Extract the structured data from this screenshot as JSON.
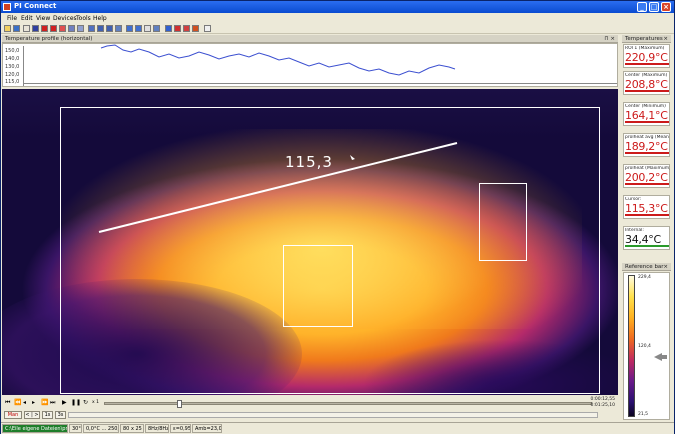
{
  "window": {
    "title": "PI Connect"
  },
  "menu": [
    "File",
    "Edit",
    "View",
    "Devices",
    "Tools",
    "Help"
  ],
  "panels": {
    "profile_title": "Temperature profile (horizontal)",
    "temps_title": "Temperatures",
    "ref_title": "Reference bar"
  },
  "profile": {
    "y_ticks": [
      "150,0",
      "140,0",
      "130,0",
      "120,0",
      "115,0"
    ],
    "line_color": "#3b4fd0"
  },
  "thermal": {
    "line_value": "115,3"
  },
  "temperatures": [
    {
      "label": "ROI 1 (Maximum)",
      "value": "220,9°C"
    },
    {
      "label": "Center (Maximum)",
      "value": "208,8°C"
    },
    {
      "label": "Center (Minimum)",
      "value": "164,1°C"
    },
    {
      "label": "prolheat avg (Mean val",
      "value": "189,2°C"
    },
    {
      "label": "prolheat (Maximum)",
      "value": "200,2°C"
    },
    {
      "label": "Cursor:",
      "value": "115,3°C"
    },
    {
      "label": "Internal:",
      "value": "34,4°C"
    }
  ],
  "reference": {
    "max": "229,4",
    "mid": "120,4",
    "min": "21,5"
  },
  "playback": {
    "time_top": "0:00:12,55",
    "time_bottom": "0:01:25,10",
    "speed": "x 1"
  },
  "bottom_buttons": [
    "Man",
    "< | >",
    "1s",
    "3s"
  ],
  "status": {
    "file": "C:\\Eile eigene Dateien\\prh3.ravi",
    "fov": "30°",
    "range": "0,0°C ... 250,0°C",
    "res": "80 x 25",
    "freq": "8Hz/8Hz",
    "eps": "ε=0,950",
    "amb": "Amb=23,0°C"
  },
  "colors": {
    "accent": "#0a4bd0",
    "temp_text": "#cc1a1a",
    "file_status": "#1e7e2a"
  }
}
